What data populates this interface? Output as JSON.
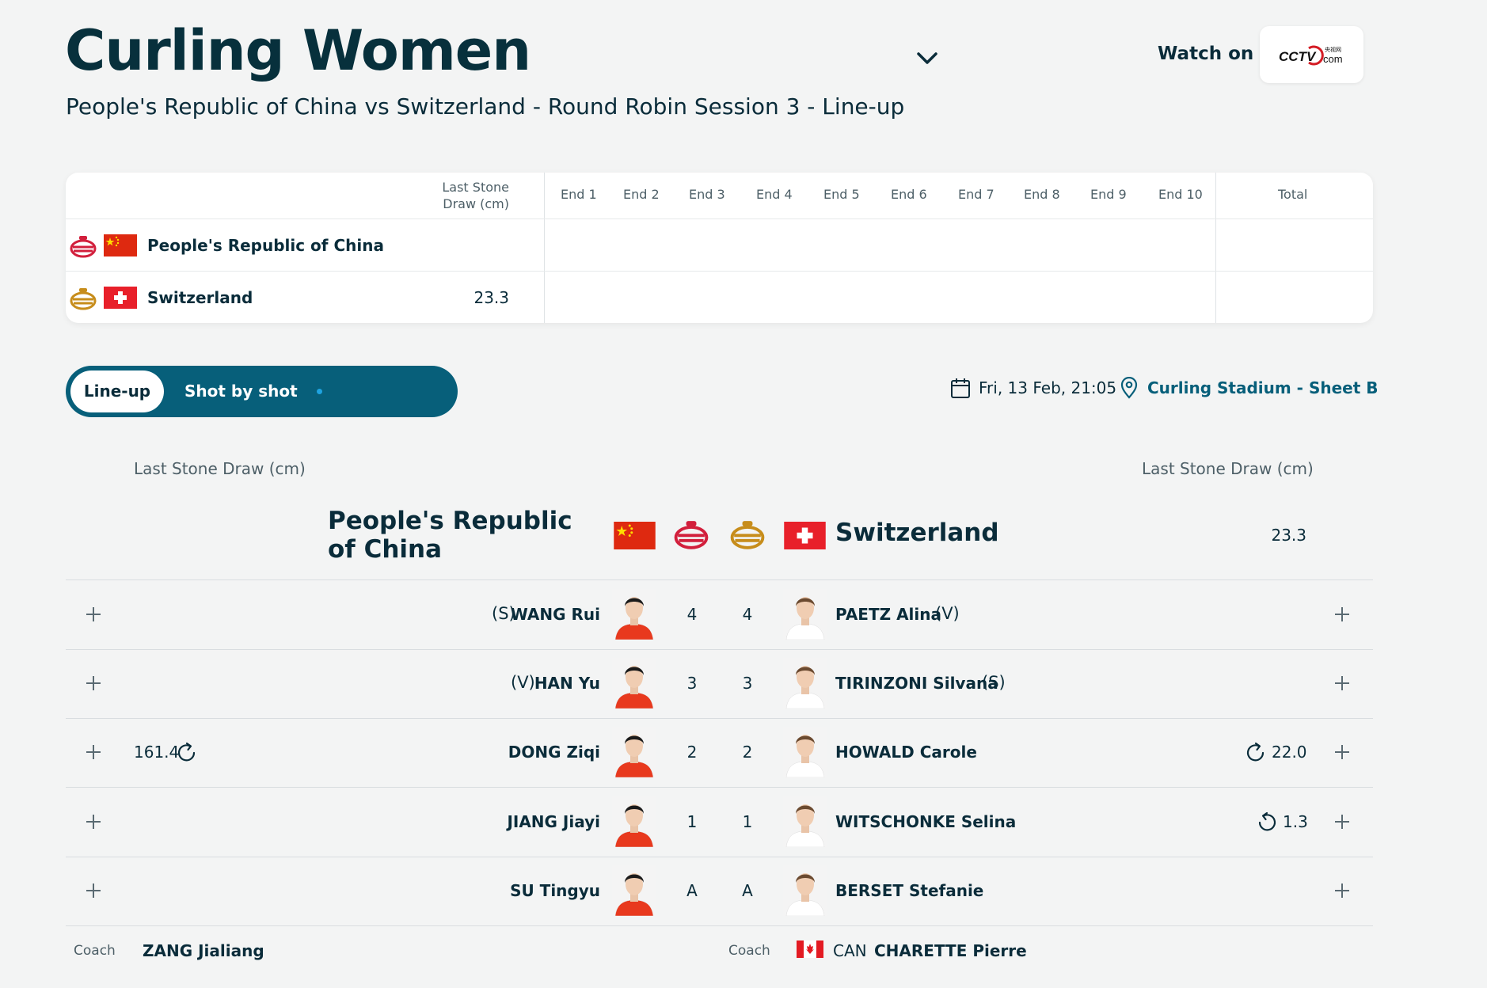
{
  "header": {
    "title": "Curling Women",
    "subtitle": "People's Republic of China vs Switzerland - Round Robin Session 3 - Line-up",
    "watch_label": "Watch on",
    "broadcaster_logo_text": "CCTV.com",
    "icons": {
      "dropdown": "chevron-down-icon"
    }
  },
  "scorecard": {
    "headers": {
      "last_stone": "Last Stone Draw (cm)",
      "ends": [
        "End 1",
        "End 2",
        "End 3",
        "End 4",
        "End 5",
        "End 6",
        "End 7",
        "End 8",
        "End 9",
        "End 10"
      ],
      "total": "Total"
    },
    "teams": [
      {
        "name": "People's Republic of China",
        "stone_color": "#d21f3c",
        "last_stone": ""
      },
      {
        "name": "Switzerland",
        "stone_color": "#c78d1b",
        "last_stone": "23.3"
      }
    ]
  },
  "tabs": {
    "lineup": "Line-up",
    "shot_by_shot": "Shot by shot"
  },
  "event": {
    "date": "Fri, 13 Feb, 21:05",
    "location": "Curling Stadium - Sheet B",
    "icons": {
      "date": "calendar-icon",
      "location": "location-pin-icon"
    }
  },
  "lineup": {
    "lsd_header": "Last Stone Draw (cm)",
    "home": {
      "name": "People's Republic of China",
      "lsd": "",
      "players": [
        {
          "position": "(S)",
          "name": "WANG Rui",
          "order": "4",
          "lsd": ""
        },
        {
          "position": "(V)",
          "name": "HAN Yu",
          "order": "3",
          "lsd": ""
        },
        {
          "position": "",
          "name": "DONG Ziqi",
          "order": "2",
          "lsd": "161.4"
        },
        {
          "position": "",
          "name": "JIANG Jiayi",
          "order": "1",
          "lsd": ""
        },
        {
          "position": "",
          "name": "SU Tingyu",
          "order": "A",
          "lsd": ""
        }
      ],
      "coach_label": "Coach",
      "coach": "ZANG Jialiang"
    },
    "away": {
      "name": "Switzerland",
      "lsd": "23.3",
      "players": [
        {
          "position": "(V)",
          "name": "PAETZ Alina",
          "order": "4",
          "lsd": ""
        },
        {
          "position": "(S)",
          "name": "TIRINZONI Silvana",
          "order": "3",
          "lsd": ""
        },
        {
          "position": "",
          "name": "HOWALD Carole",
          "order": "2",
          "lsd": "22.0"
        },
        {
          "position": "",
          "name": "WITSCHONKE Selina",
          "order": "1",
          "lsd": "1.3"
        },
        {
          "position": "",
          "name": "BERSET Stefanie",
          "order": "A",
          "lsd": ""
        }
      ],
      "coach_label": "Coach",
      "coach_noc": "CAN",
      "coach": "CHARETTE Pierre"
    }
  },
  "colors": {
    "accent": "#075f7a",
    "china_red": "#de2910",
    "swiss_red": "#e8202a",
    "home_stone": "#d21f3c",
    "away_stone": "#c78d1b"
  }
}
